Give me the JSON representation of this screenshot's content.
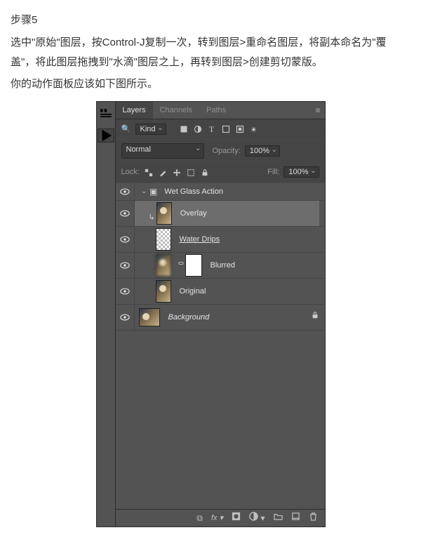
{
  "article": {
    "step_title": "步骤5",
    "p1": "选中\"原始\"图层，按Control-J复制一次，转到图层>重命名图层，将副本命名为\"覆盖\"，将此图层拖拽到\"水滴\"图层之上，再转到图层>创建剪切蒙版。",
    "p2": "你的动作面板应该如下图所示。"
  },
  "tabs": {
    "layers": "Layers",
    "channels": "Channels",
    "paths": "Paths"
  },
  "filter_row": {
    "kind_label": "Kind"
  },
  "blend_row": {
    "mode": "Normal",
    "opacity_label": "Opacity:",
    "opacity_value": "100%"
  },
  "lock_row": {
    "lock_label": "Lock:",
    "fill_label": "Fill:",
    "fill_value": "100%"
  },
  "layers": {
    "group": "Wet Glass Action",
    "overlay": "Overlay",
    "water_drips": "Water Drips ",
    "blurred": "Blurred",
    "original": "Original",
    "background": "Background"
  },
  "search_placeholder": "ρ"
}
